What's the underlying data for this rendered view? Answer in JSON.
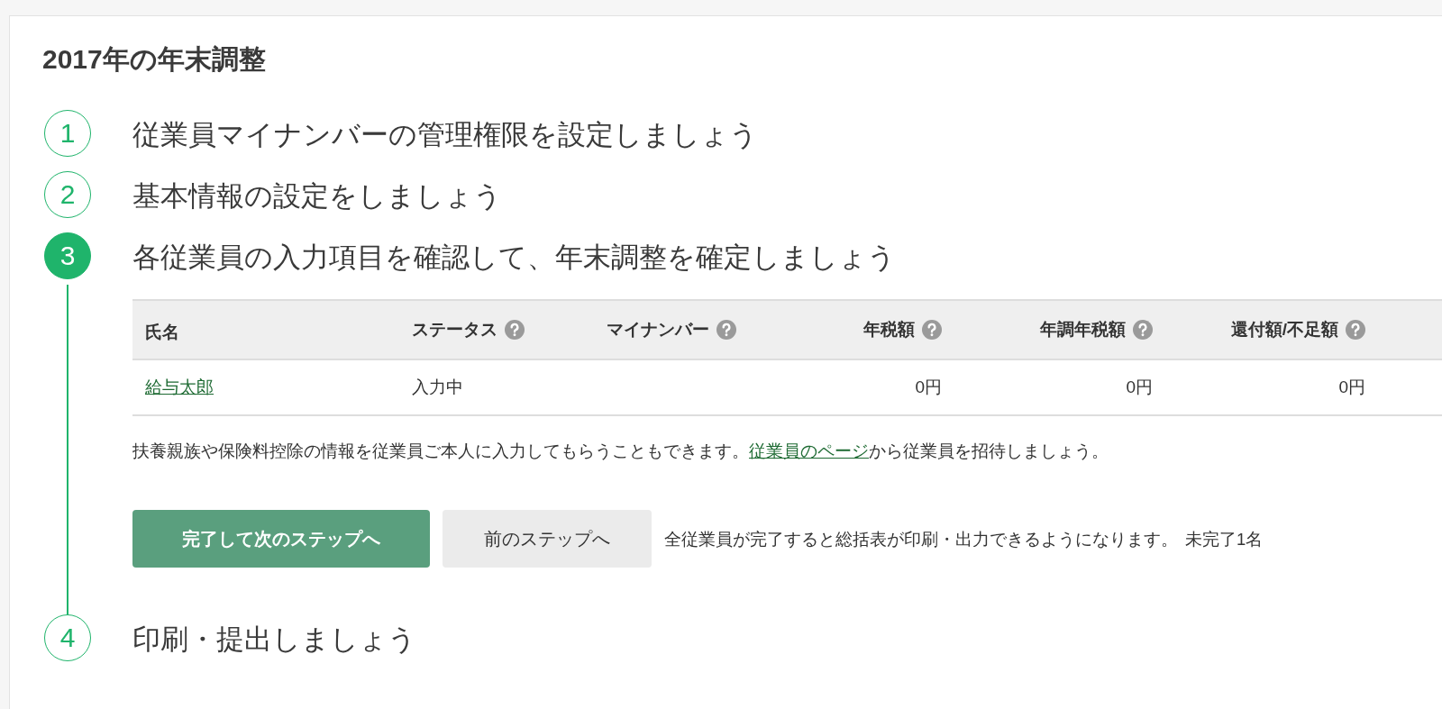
{
  "title": "2017年の年末調整",
  "steps": [
    {
      "number": "1",
      "label": "従業員マイナンバーの管理権限を設定しましょう",
      "selected": false
    },
    {
      "number": "2",
      "label": "基本情報の設定をしましょう",
      "selected": false
    },
    {
      "number": "3",
      "label": "各従業員の入力項目を確認して、年末調整を確定しましょう",
      "selected": true
    },
    {
      "number": "4",
      "label": "印刷・提出しましょう",
      "selected": false
    }
  ],
  "table": {
    "columns": [
      {
        "label": "氏名",
        "kind": "name"
      },
      {
        "label": "ステータス",
        "kind": "text"
      },
      {
        "label": "マイナンバー",
        "kind": "text"
      },
      {
        "label": "年税額",
        "kind": "amount"
      },
      {
        "label": "年調年税額",
        "kind": "amount"
      },
      {
        "label": "還付額/不足額",
        "kind": "amount"
      }
    ],
    "rows": [
      {
        "name": "給与太郎",
        "status": "入力中",
        "tax": "0円",
        "adjusted_tax": "0円",
        "refund": "0円"
      }
    ]
  },
  "note": {
    "before": "扶養親族や保険料控除の情報を従業員ご本人に入力してもらうこともできます。",
    "link": "従業員のページ",
    "after": "から従業員を招待しましょう。"
  },
  "primary_button": "完了して次のステップへ",
  "secondary_button": "前のステップへ",
  "status_text": "全従業員が完了すると総括表が印刷・出力できるようになります。",
  "remaining": "未完了1名"
}
